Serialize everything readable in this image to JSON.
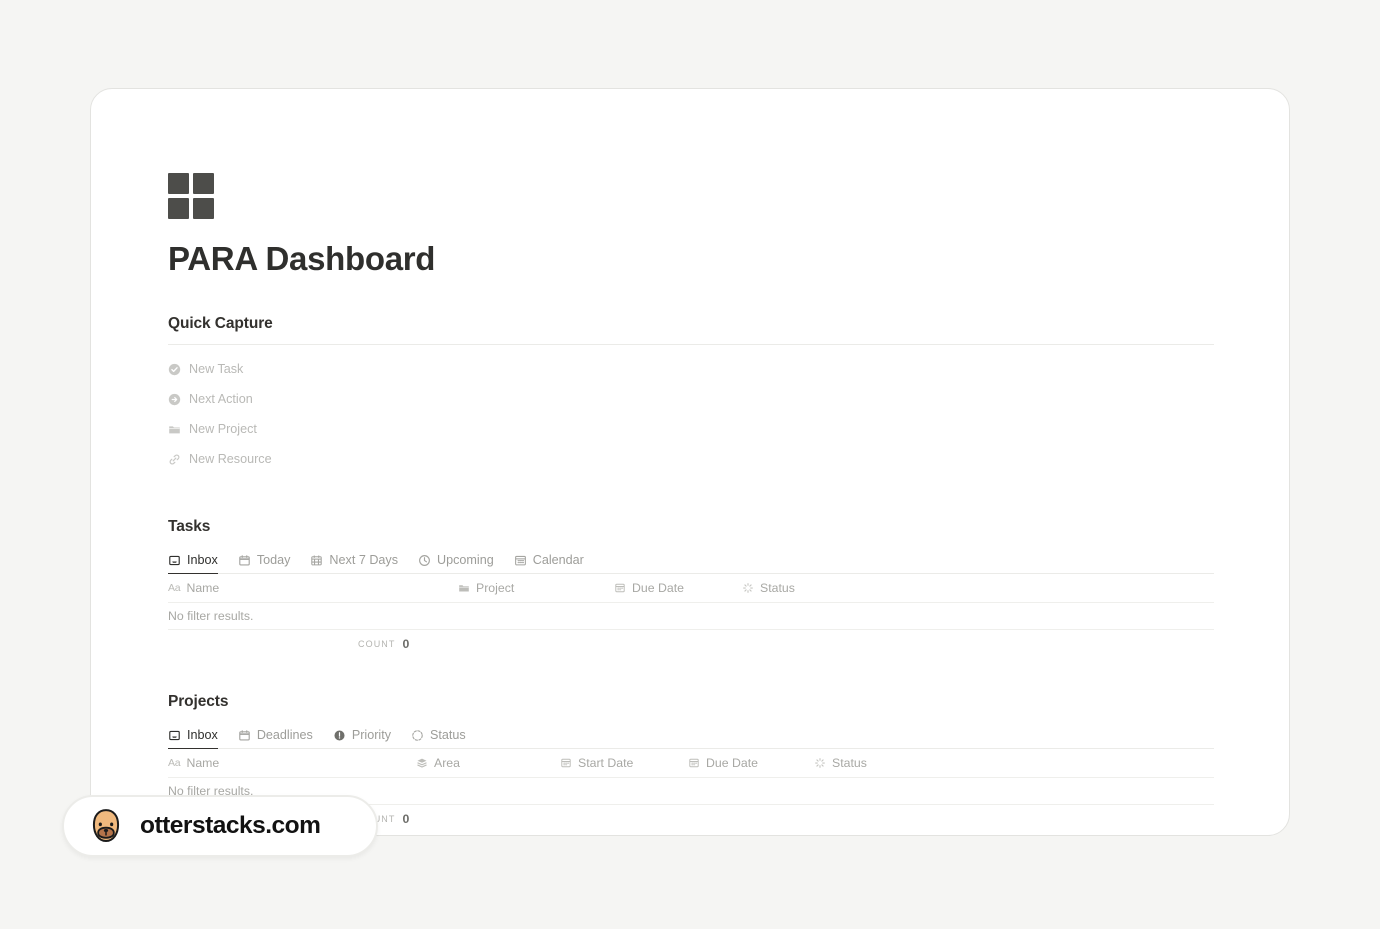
{
  "page": {
    "title": "PARA Dashboard",
    "logo_icon": "grid-squares-icon",
    "background_color": "#f5f5f3",
    "card_color": "#ffffff"
  },
  "quick_capture": {
    "heading": "Quick Capture",
    "items": [
      {
        "label": "New Task",
        "icon": "check-circle-icon"
      },
      {
        "label": "Next Action",
        "icon": "arrow-right-circle-icon"
      },
      {
        "label": "New Project",
        "icon": "folder-icon"
      },
      {
        "label": "New Resource",
        "icon": "link-icon"
      }
    ]
  },
  "tasks": {
    "heading": "Tasks",
    "tabs": [
      {
        "label": "Inbox",
        "icon": "inbox-icon",
        "active": true
      },
      {
        "label": "Today",
        "icon": "calendar-icon",
        "active": false
      },
      {
        "label": "Next 7 Days",
        "icon": "calendar-grid-icon",
        "active": false
      },
      {
        "label": "Upcoming",
        "icon": "clock-icon",
        "active": false
      },
      {
        "label": "Calendar",
        "icon": "calendar-days-icon",
        "active": false
      }
    ],
    "columns": [
      {
        "label": "Name",
        "icon": "text-aa-icon"
      },
      {
        "label": "Project",
        "icon": "folder-icon"
      },
      {
        "label": "Due Date",
        "icon": "calendar-date-icon"
      },
      {
        "label": "Status",
        "icon": "status-spinner-icon"
      }
    ],
    "empty_message": "No filter results.",
    "count_label": "Count",
    "count_value": "0"
  },
  "projects": {
    "heading": "Projects",
    "tabs": [
      {
        "label": "Inbox",
        "icon": "inbox-icon",
        "active": true
      },
      {
        "label": "Deadlines",
        "icon": "calendar-icon",
        "active": false
      },
      {
        "label": "Priority",
        "icon": "exclamation-circle-icon",
        "active": false
      },
      {
        "label": "Status",
        "icon": "dashed-circle-icon",
        "active": false
      }
    ],
    "columns": [
      {
        "label": "Name",
        "icon": "text-aa-icon"
      },
      {
        "label": "Area",
        "icon": "layers-icon"
      },
      {
        "label": "Start Date",
        "icon": "calendar-date-icon"
      },
      {
        "label": "Due Date",
        "icon": "calendar-date-icon"
      },
      {
        "label": "Status",
        "icon": "status-spinner-icon"
      }
    ],
    "empty_message": "No filter results.",
    "count_label": "Count",
    "count_value": "0"
  },
  "watermark": {
    "text": "otterstacks.com",
    "icon": "otter-mascot-icon"
  }
}
